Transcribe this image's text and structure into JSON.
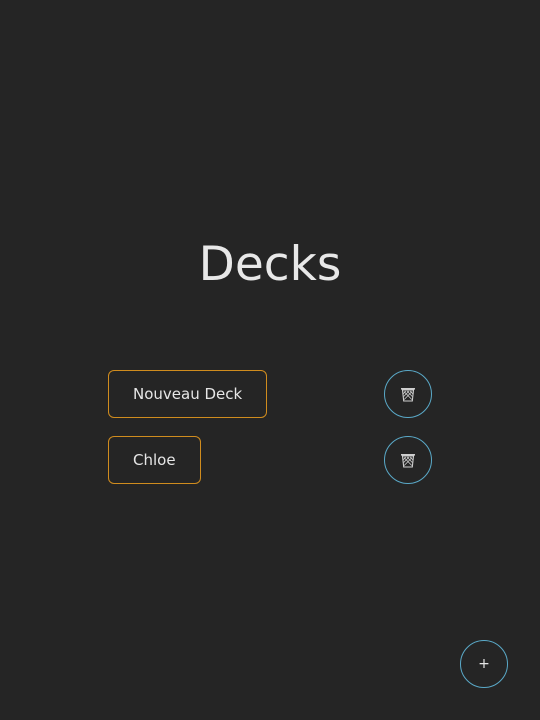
{
  "page": {
    "title": "Decks"
  },
  "decks": [
    {
      "label": "Nouveau Deck",
      "delete_icon": "trash-icon"
    },
    {
      "label": "Chloe",
      "delete_icon": "trash-icon"
    }
  ],
  "add_button": {
    "label": "+"
  },
  "colors": {
    "background": "#252525",
    "deck_border": "#d08c1e",
    "circle_border": "#5aa9c8",
    "text": "#e6e6e6"
  }
}
